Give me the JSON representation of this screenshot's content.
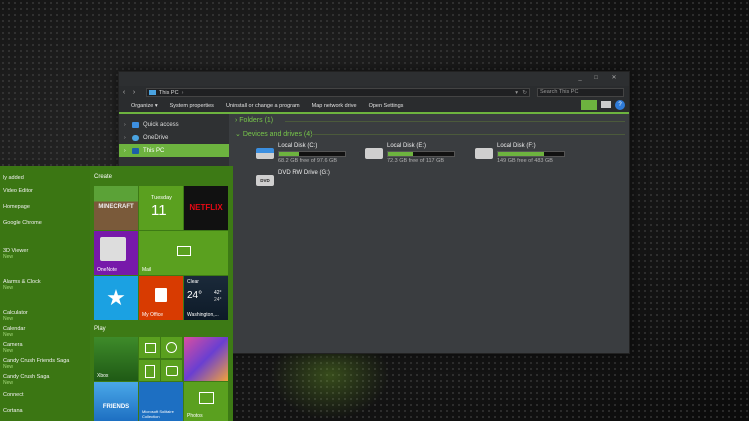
{
  "explorer": {
    "window_controls": [
      "_",
      "□",
      "✕"
    ],
    "address": "This PC",
    "address_sep": "›",
    "search_placeholder": "Search This PC",
    "commands": [
      "Organize ▾",
      "System properties",
      "Uninstall or change a program",
      "Map network drive",
      "Open Settings"
    ],
    "nav": [
      {
        "label": "Quick access",
        "icon": "star-icon"
      },
      {
        "label": "OneDrive",
        "icon": "cloud-icon"
      },
      {
        "label": "This PC",
        "icon": "pc-icon",
        "selected": true
      }
    ],
    "folders_header": "Folders (1)",
    "devices_header": "Devices and drives (4)",
    "drives": [
      {
        "name": "Local Disk (C:)",
        "free": "68.2 GB free of 97.6 GB",
        "used_fraction": 0.3
      },
      {
        "name": "Local Disk (E:)",
        "free": "72.3 GB free of 117 GB",
        "used_fraction": 0.38
      },
      {
        "name": "Local Disk (F:)",
        "free": "149 GB free of 483 GB",
        "used_fraction": 0.69
      },
      {
        "name": "DVD RW Drive (G:)",
        "free": "",
        "used_fraction": null
      }
    ],
    "dvd_label": "DVD"
  },
  "start_menu": {
    "recent_header": "ly added",
    "apps": [
      {
        "label": "Video Editor",
        "new": ""
      },
      {
        "label": "Homepage",
        "new": ""
      },
      {
        "label": "Google Chrome",
        "new": ""
      },
      {
        "label": "3D Viewer",
        "new": "New"
      },
      {
        "label": "Alarms & Clock",
        "new": "New"
      },
      {
        "label": "Calculator",
        "new": "New"
      },
      {
        "label": "Calendar",
        "new": "New"
      },
      {
        "label": "Camera",
        "new": "New"
      },
      {
        "label": "Candy Crush Friends Saga",
        "new": "New"
      },
      {
        "label": "Candy Crush Saga",
        "new": "New"
      },
      {
        "label": "Connect",
        "new": ""
      },
      {
        "label": "Cortana",
        "new": ""
      }
    ],
    "create_header": "Create",
    "play_header": "Play",
    "tiles": {
      "minecraft": "MINECRAFT",
      "calendar_day": "Tuesday",
      "calendar_date": "11",
      "netflix": "NETFLIX",
      "onenote": "OneNote",
      "mail": "Mail",
      "myoffice": "My Office",
      "weather_cond": "Clear",
      "weather_temp": "24°",
      "weather_hi": "42°",
      "weather_lo": "24°",
      "weather_city": "Washington,...",
      "xbox": "Xbox",
      "friends": "FRIENDS",
      "solitaire": "Microsoft Solitaire Collection",
      "photos": "Photos"
    }
  },
  "colors": {
    "accent": "#6db33f",
    "start_bg": "#3d7a15"
  }
}
